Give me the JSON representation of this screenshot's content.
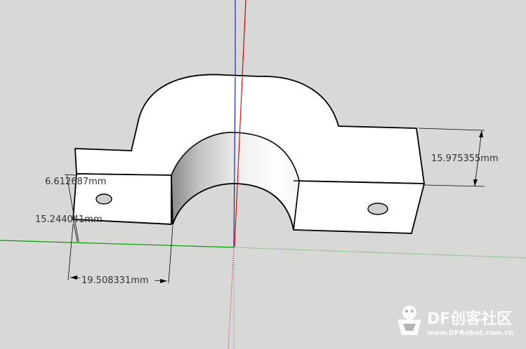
{
  "dimensions": {
    "width_label": "15.975355mm",
    "hole_offset_label": "6.612687mm",
    "height_label": "15.244041mm",
    "span_label": "19.508331mm"
  },
  "watermark": {
    "brand": "DF创客社区",
    "url": "www.DFRobot.com.cn"
  },
  "colors": {
    "background": "#d8d8d6",
    "model_face": "#ffffff",
    "edge": "#000000",
    "axis_red": "#d00000",
    "axis_green": "#00a000",
    "axis_blue": "#2020c0"
  }
}
